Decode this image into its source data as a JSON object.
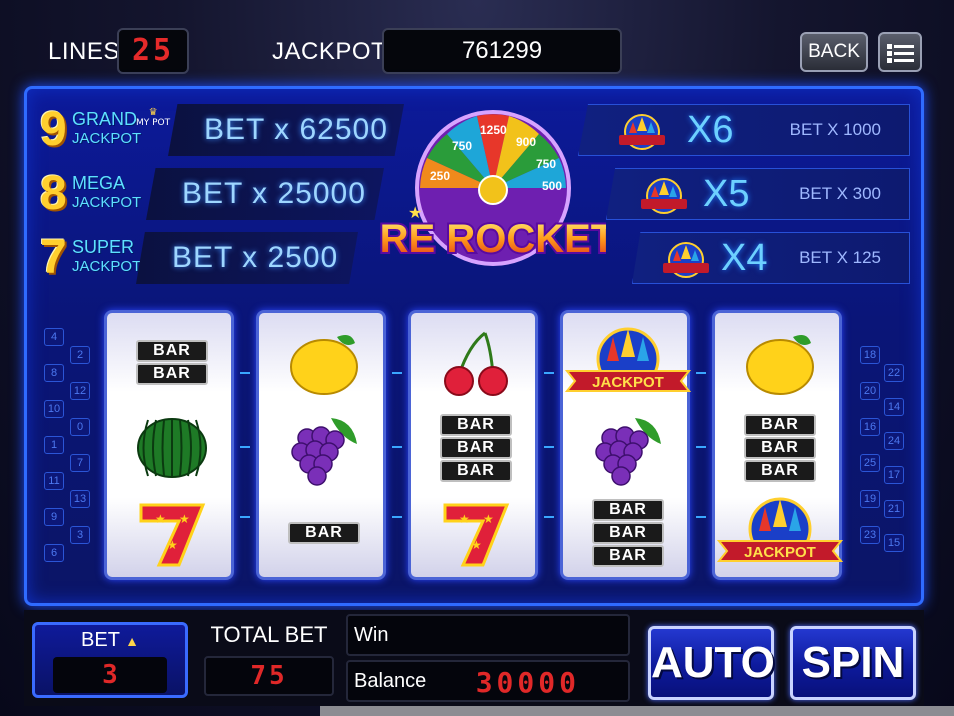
{
  "top": {
    "lines_label": "LINES",
    "lines_value": "25",
    "jackpot_label": "JACKPOT",
    "jackpot_value": "761299",
    "back_label": "BACK",
    "menu_icon": "hamburger-menu-icon"
  },
  "jackpots": [
    {
      "number": "9",
      "title": "GRAND",
      "subtitle": "JACKPOT",
      "badge": "MY POT",
      "bet": "BET x 62500"
    },
    {
      "number": "8",
      "title": "MEGA",
      "subtitle": "JACKPOT",
      "bet": "BET x 25000"
    },
    {
      "number": "7",
      "title": "SUPER",
      "subtitle": "JACKPOT",
      "bet": "BET x 2500"
    }
  ],
  "multipliers": [
    {
      "mult": "X6",
      "bet": "BET X 1000"
    },
    {
      "mult": "X5",
      "bet": "BET X 300"
    },
    {
      "mult": "X4",
      "bet": "BET X 125"
    }
  ],
  "logo": {
    "title": "FIRE ROCKETS",
    "wheel_values": [
      "250",
      "750",
      "1250",
      "900",
      "750",
      "500",
      "500"
    ]
  },
  "line_numbers": {
    "left_outer": [
      "4",
      "8",
      "10",
      "1",
      "11",
      "9",
      "6"
    ],
    "left_inner": [
      "2",
      "12",
      "0",
      "7",
      "13",
      "3"
    ],
    "right_inner": [
      "18",
      "20",
      "16",
      "25",
      "19",
      "23"
    ],
    "right_outer": [
      "22",
      "14",
      "24",
      "17",
      "21",
      "15"
    ]
  },
  "reels": [
    [
      "bar-double",
      "watermelon",
      "seven"
    ],
    [
      "lemon",
      "grapes",
      "bar-single"
    ],
    [
      "cherry",
      "bar-triple",
      "seven"
    ],
    [
      "jackpot",
      "grapes",
      "bar-triple"
    ],
    [
      "lemon",
      "bar-triple",
      "jackpot"
    ]
  ],
  "bar_text": "BAR",
  "jackpot_symbol_text": "JACKPOT",
  "bottom": {
    "bet_label": "BET",
    "bet_value": "3",
    "total_bet_label": "TOTAL BET",
    "total_bet_value": "75",
    "win_label": "Win",
    "win_value": "",
    "balance_label": "Balance",
    "balance_value": "30000",
    "auto_label": "AUTO",
    "spin_label": "SPIN"
  },
  "colors": {
    "frame": "#2f6bff",
    "digit_red": "#e02828",
    "gold": "#ffcf2e",
    "cyan": "#5ee0ff"
  }
}
